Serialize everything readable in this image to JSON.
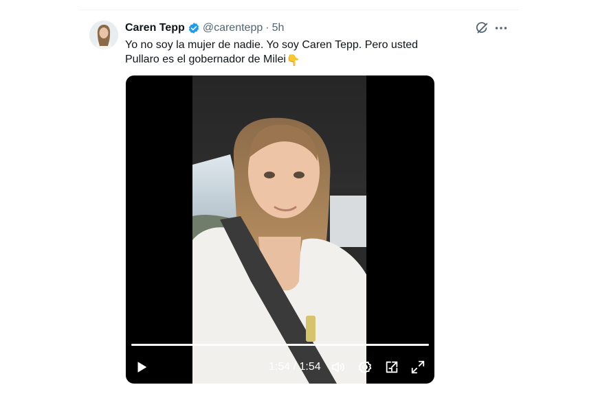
{
  "tweet": {
    "display_name": "Caren Tepp",
    "handle": "@carentepp",
    "separator": "·",
    "time": "5h",
    "text": "Yo no soy la mujer de nadie. Yo soy Caren Tepp. Pero usted Pullaro es el gobernador de Milei",
    "emoji": "👇"
  },
  "video": {
    "current_time": "1:54",
    "time_separator": "/",
    "duration": "1:54",
    "progress_fraction": 1.0
  },
  "icons": {
    "verified": "verified-badge-icon",
    "grok": "grok-icon",
    "more": "more-icon",
    "play": "play-icon",
    "volume": "volume-icon",
    "settings": "settings-icon",
    "pip": "pip-icon",
    "fullscreen": "fullscreen-icon"
  },
  "colors": {
    "accent": "#1d9bf0",
    "text_primary": "#0f1419",
    "text_secondary": "#536471",
    "video_background": "#000000"
  }
}
